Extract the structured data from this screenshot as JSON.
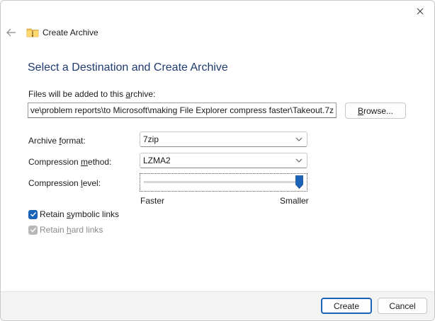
{
  "window": {
    "title": "Create Archive"
  },
  "heading": "Select a Destination and Create Archive",
  "files": {
    "label_pre": "Files will be added to this ",
    "label_accel": "a",
    "label_post": "rchive:",
    "path_value": "ve\\problem reports\\to Microsoft\\making File Explorer compress faster\\Takeout.7z",
    "browse_pre": "",
    "browse_accel": "B",
    "browse_post": "rowse..."
  },
  "format": {
    "label_pre": "Archive ",
    "label_accel": "f",
    "label_post": "ormat:",
    "value": "7zip"
  },
  "method": {
    "label_pre": "Compression ",
    "label_accel": "m",
    "label_post": "ethod:",
    "value": "LZMA2"
  },
  "level": {
    "label_pre": "Compression ",
    "label_accel": "l",
    "label_post": "evel:",
    "min_label": "Faster",
    "max_label": "Smaller",
    "value_fraction": 1.0
  },
  "options": {
    "symbolic": {
      "pre": "Retain ",
      "accel": "s",
      "post": "ymbolic links",
      "checked": true,
      "enabled": true
    },
    "hard": {
      "pre": "Retain ",
      "accel": "h",
      "post": "ard links",
      "checked": true,
      "enabled": false
    }
  },
  "footer": {
    "create_label": "Create",
    "cancel_label": "Cancel"
  },
  "colors": {
    "accent": "#1a63b8",
    "heading": "#1f3a6e",
    "disabled": "#b8b8b8"
  },
  "icons": {
    "close": "close-icon",
    "back": "back-arrow-icon",
    "folder": "zip-folder-icon",
    "chevron": "chevron-down-icon",
    "check": "checkmark-icon"
  }
}
